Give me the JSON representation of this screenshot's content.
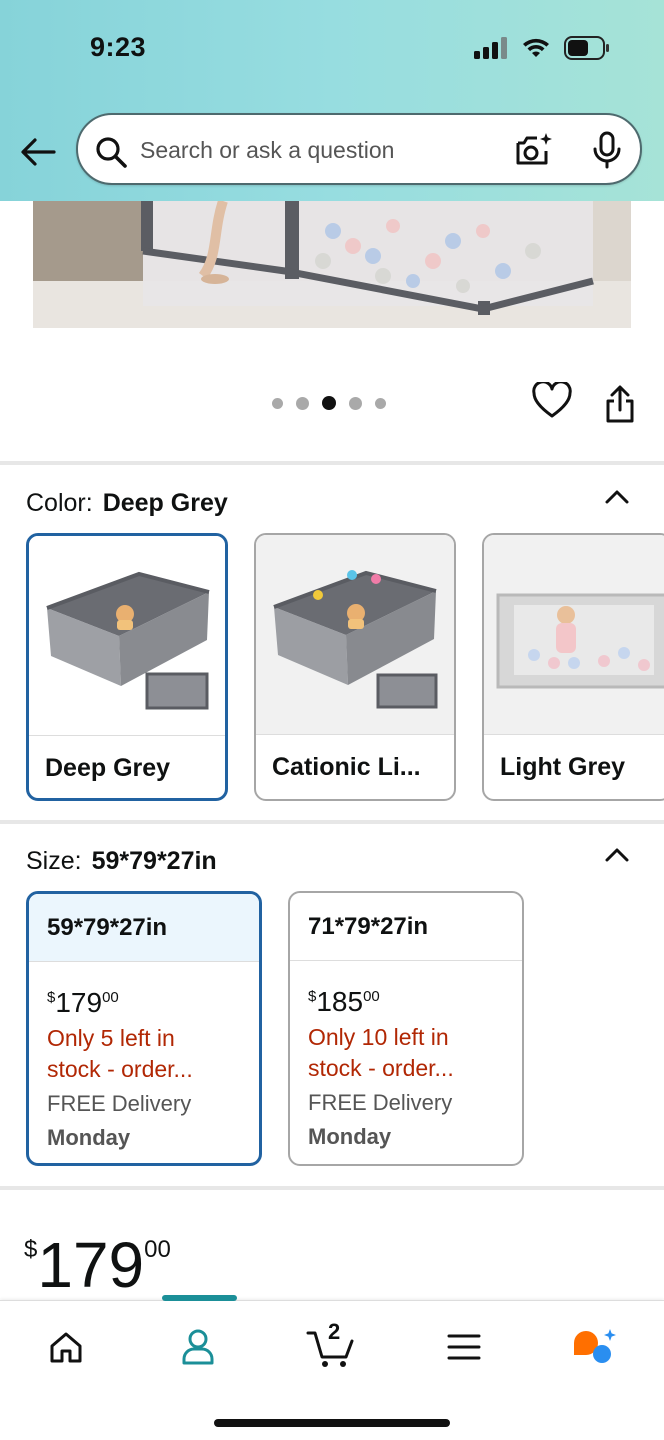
{
  "status_bar": {
    "time": "9:23"
  },
  "search": {
    "placeholder": "Search or ask a question"
  },
  "carousel": {
    "dot_count": 5,
    "active_index": 2
  },
  "color": {
    "label": "Color:",
    "selected": "Deep Grey",
    "options": [
      {
        "name": "Deep Grey"
      },
      {
        "name": "Cationic Li..."
      },
      {
        "name": "Light Grey"
      }
    ]
  },
  "size": {
    "label": "Size:",
    "selected": "59*79*27in",
    "options": [
      {
        "name": "59*79*27in",
        "price_symbol": "$",
        "price_whole": "179",
        "price_cents": "00",
        "stock_line1": "Only 5 left in",
        "stock_line2": "stock - order...",
        "delivery": "FREE Delivery",
        "delivery_day": "Monday"
      },
      {
        "name": "71*79*27in",
        "price_symbol": "$",
        "price_whole": "185",
        "price_cents": "00",
        "stock_line1": "Only 10 left in",
        "stock_line2": "stock - order...",
        "delivery": "FREE Delivery",
        "delivery_day": "Monday"
      }
    ]
  },
  "price": {
    "symbol": "$",
    "whole": "179",
    "cents": "00"
  },
  "bottom_nav": {
    "cart_count": "2",
    "items": [
      "home-icon",
      "account-icon",
      "cart-icon",
      "menu-icon",
      "assistant-icon"
    ],
    "active_index": 1
  },
  "colors": {
    "selected_border": "#2162a1",
    "stock_red": "#b12704",
    "nav_accent": "#1b8f98"
  }
}
